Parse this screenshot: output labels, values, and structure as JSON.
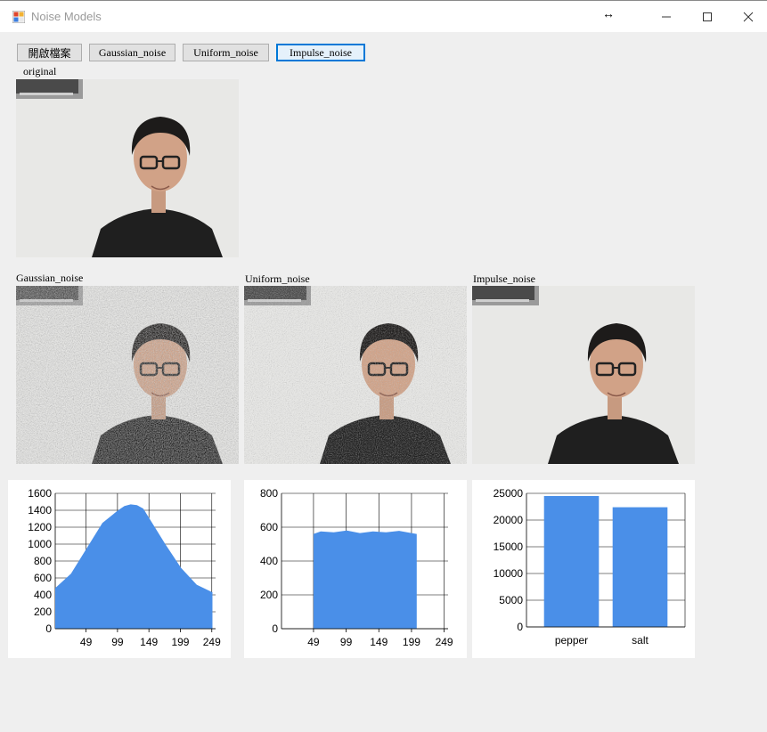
{
  "window": {
    "title": "Noise Models",
    "resize_glyph": "↔"
  },
  "toolbar": {
    "open_file": "開啟檔案",
    "gaussian": "Gaussian_noise",
    "uniform": "Uniform_noise",
    "impulse": "Impulse_noise"
  },
  "labels": {
    "original": "original",
    "gaussian": "Gaussian_noise",
    "uniform": "Uniform_noise",
    "impulse": "Impulse_noise"
  },
  "colors": {
    "bar": "#4a8fe8",
    "accent": "#0078d7"
  },
  "chart_data": [
    {
      "type": "area",
      "name": "gaussian-histogram",
      "x_ticks": [
        49,
        99,
        149,
        199,
        249
      ],
      "y_ticks": [
        0,
        200,
        400,
        600,
        800,
        1000,
        1200,
        1400,
        1600
      ],
      "xlim": [
        0,
        255
      ],
      "ylim": [
        0,
        1600
      ],
      "grid": true,
      "x": [
        0,
        25,
        50,
        75,
        100,
        110,
        120,
        130,
        140,
        150,
        175,
        200,
        225,
        250
      ],
      "values": [
        480,
        650,
        950,
        1250,
        1400,
        1450,
        1470,
        1460,
        1420,
        1300,
        1000,
        720,
        520,
        430
      ]
    },
    {
      "type": "area",
      "name": "uniform-histogram",
      "x_ticks": [
        49,
        99,
        149,
        199,
        249
      ],
      "y_ticks": [
        0,
        200,
        400,
        600,
        800
      ],
      "xlim": [
        0,
        255
      ],
      "ylim": [
        0,
        800
      ],
      "grid": true,
      "x": [
        49,
        60,
        80,
        100,
        120,
        140,
        160,
        180,
        199,
        207
      ],
      "values": [
        560,
        575,
        570,
        580,
        565,
        575,
        570,
        578,
        565,
        560
      ]
    },
    {
      "type": "bar",
      "name": "impulse-histogram",
      "categories": [
        "pepper",
        "salt"
      ],
      "values": [
        24500,
        22400
      ],
      "y_ticks": [
        0,
        5000,
        10000,
        15000,
        20000,
        25000
      ],
      "ylim": [
        0,
        25000
      ],
      "grid": true
    }
  ]
}
